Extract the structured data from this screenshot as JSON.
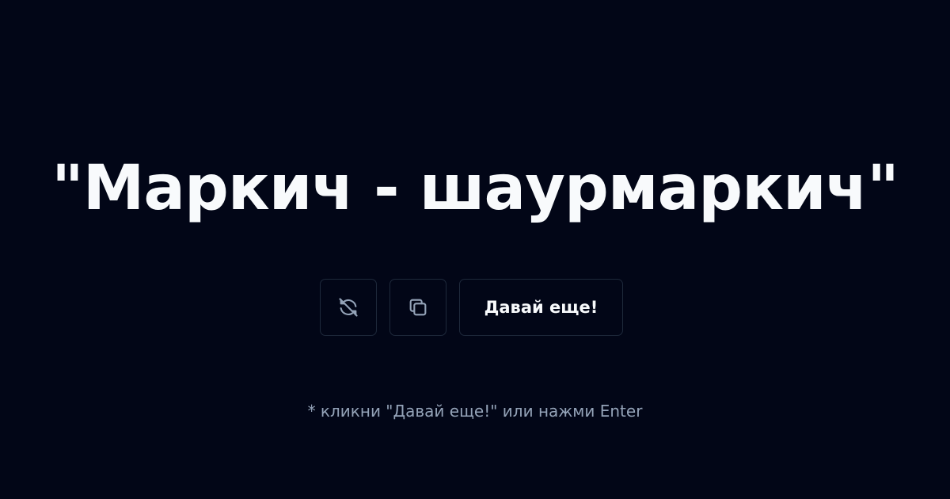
{
  "colors": {
    "background": "#020617",
    "text": "#f8fafc",
    "border": "#1e293b",
    "icon": "#94a3b8",
    "hint": "#94a3b8"
  },
  "headline": {
    "text": "\"Маркич - шаурмаркич\""
  },
  "actions": {
    "refresh_off_icon": "refresh-off-icon",
    "copy_icon": "copy-icon",
    "more_label": "Давай еще!"
  },
  "hint": {
    "text": "* кликни \"Давай еще!\" или нажми Enter"
  }
}
